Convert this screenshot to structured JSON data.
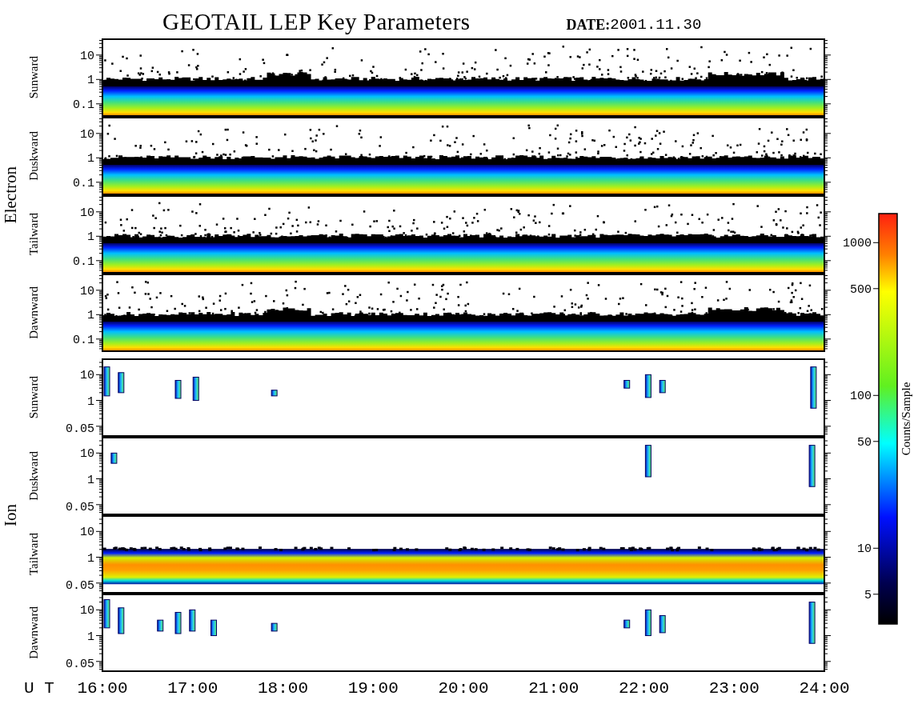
{
  "title": "GEOTAIL LEP Key Parameters",
  "date_label": "DATE:",
  "date": "2001.11.30",
  "groups": [
    {
      "name": "Electron",
      "panels": [
        {
          "direction": "Sunward",
          "kind": "dense",
          "yticks": [
            "10",
            "1",
            "0.1"
          ]
        },
        {
          "direction": "Duskward",
          "kind": "dense",
          "yticks": [
            "10",
            "1",
            "0.1"
          ]
        },
        {
          "direction": "Tailward",
          "kind": "dense",
          "yticks": [
            "10",
            "1",
            "0.1"
          ]
        },
        {
          "direction": "Dawnward",
          "kind": "dense",
          "yticks": [
            "10",
            "1",
            "0.1"
          ]
        }
      ]
    },
    {
      "name": "Ion",
      "panels": [
        {
          "direction": "Sunward",
          "kind": "sparse",
          "yticks": [
            "10",
            "1",
            "0.05"
          ]
        },
        {
          "direction": "Duskward",
          "kind": "sparse",
          "yticks": [
            "10",
            "1",
            "0.05"
          ]
        },
        {
          "direction": "Tailward",
          "kind": "belt",
          "yticks": [
            "10",
            "1",
            "0.05"
          ]
        },
        {
          "direction": "Dawnward",
          "kind": "sparse",
          "yticks": [
            "10",
            "1",
            "0.05"
          ]
        }
      ]
    }
  ],
  "colorbar": {
    "label": "Counts/Sample",
    "ticks": [
      "1000",
      "500",
      "100",
      "50",
      "10",
      "5"
    ]
  },
  "x_axis": {
    "label": "U T",
    "ticks": [
      "16:00",
      "17:00",
      "18:00",
      "19:00",
      "20:00",
      "21:00",
      "22:00",
      "23:00",
      "24:00"
    ]
  }
}
